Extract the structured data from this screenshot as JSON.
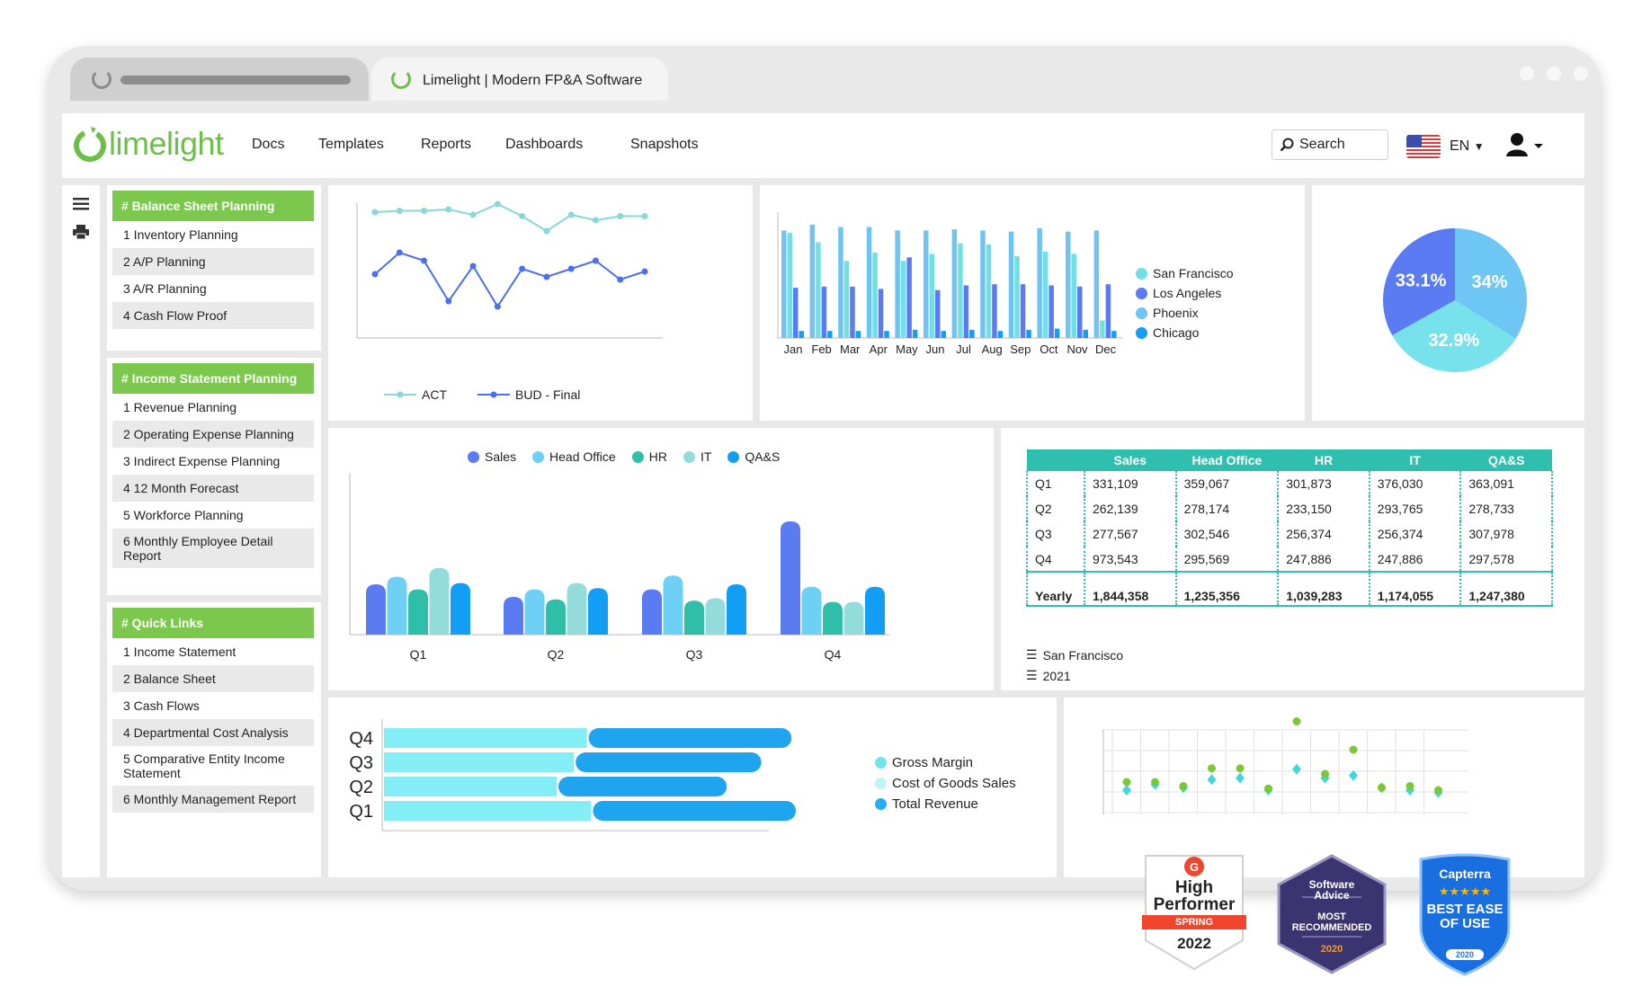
{
  "browser": {
    "tab_title": "Limelight | Modern FP&A Software"
  },
  "brand": {
    "name": "limelight",
    "color": "#6cc04a"
  },
  "nav": {
    "items": [
      "Docs",
      "Templates",
      "Reports",
      "Dashboards",
      "Snapshots"
    ],
    "search_placeholder": "Search",
    "language": "EN"
  },
  "sidebar": {
    "sections": [
      {
        "title": "# Balance Sheet Planning",
        "items": [
          "1  Inventory Planning",
          "2  A/P Planning",
          "3  A/R Planning",
          "4  Cash Flow Proof"
        ]
      },
      {
        "title": "# Income Statement Planning",
        "items": [
          "1  Revenue Planning",
          "2  Operating Expense Planning",
          "3  Indirect Expense Planning",
          "4  12 Month Forecast",
          "5  Workforce Planning",
          "6  Monthly Employee Detail Report"
        ]
      },
      {
        "title": "# Quick Links",
        "items": [
          "1  Income Statement",
          "2  Balance Sheet",
          "3  Cash Flows",
          "4  Departmental Cost Analysis",
          "5  Comparative Entity Income Statement",
          "6  Monthly Management Report"
        ]
      }
    ]
  },
  "colors": {
    "green": "#7cc84e",
    "teal": "#2ebfae",
    "act": "#86d9d6",
    "bud": "#4a6ff0",
    "sales": "#5b7bf2",
    "head_office": "#6fd0f5",
    "hr": "#2fbfa8",
    "it": "#93dcdb",
    "qas": "#139ef5"
  },
  "line_chart": {
    "legend": [
      "ACT",
      "BUD - Final"
    ],
    "series": [
      {
        "name": "ACT",
        "values": [
          88,
          89,
          89,
          90,
          86,
          94,
          85,
          74,
          86,
          82,
          85,
          85
        ]
      },
      {
        "name": "BUD - Final",
        "values": [
          42,
          58,
          52,
          22,
          48,
          18,
          46,
          40,
          46,
          52,
          38,
          44
        ]
      }
    ]
  },
  "bar_chart_monthly": {
    "categories": [
      "Jan",
      "Feb",
      "Mar",
      "Apr",
      "May",
      "Jun",
      "Jul",
      "Aug",
      "Sep",
      "Oct",
      "Nov",
      "Dec"
    ],
    "legend": [
      "San Francisco",
      "Los Angeles",
      "Phoenix",
      "Chicago"
    ],
    "series": [
      {
        "name": "San Francisco",
        "values": [
          90,
          82,
          66,
          73,
          66,
          72,
          81,
          80,
          70,
          74,
          72,
          15
        ]
      },
      {
        "name": "Los Angeles",
        "values": [
          43,
          44,
          44,
          42,
          69,
          41,
          45,
          46,
          46,
          45,
          44,
          46
        ]
      },
      {
        "name": "Phoenix",
        "values": [
          92,
          97,
          95,
          95,
          92,
          92,
          93,
          92,
          91,
          94,
          91,
          92
        ]
      },
      {
        "name": "Chicago",
        "values": [
          6,
          6,
          6,
          6,
          7,
          6,
          7,
          6,
          7,
          8,
          7,
          6
        ]
      }
    ]
  },
  "pie_chart": {
    "slices": [
      {
        "label": "34%",
        "value": 34
      },
      {
        "label": "32.9%",
        "value": 32.9
      },
      {
        "label": "33.1%",
        "value": 33.1
      }
    ]
  },
  "quarter_chart": {
    "legend": [
      "Sales",
      "Head Office",
      "HR",
      "IT",
      "QA&S"
    ],
    "categories": [
      "Q1",
      "Q2",
      "Q3",
      "Q4"
    ],
    "series": [
      {
        "name": "Sales",
        "values": [
          40,
          30,
          36,
          90
        ]
      },
      {
        "name": "Head Office",
        "values": [
          46,
          36,
          47,
          38
        ]
      },
      {
        "name": "HR",
        "values": [
          36,
          28,
          27,
          26
        ]
      },
      {
        "name": "IT",
        "values": [
          53,
          41,
          29,
          26
        ]
      },
      {
        "name": "QA&S",
        "values": [
          41,
          37,
          40,
          38
        ]
      }
    ]
  },
  "table": {
    "headers": [
      "",
      "Sales",
      "Head Office",
      "HR",
      "IT",
      "QA&S"
    ],
    "rows": [
      [
        "Q1",
        "331,109",
        "359,067",
        "301,873",
        "376,030",
        "363,091"
      ],
      [
        "Q2",
        "262,139",
        "278,174",
        "233,150",
        "293,765",
        "278,733"
      ],
      [
        "Q3",
        "277,567",
        "302,546",
        "256,374",
        "256,374",
        "307,978"
      ],
      [
        "Q4",
        "973,543",
        "295,569",
        "247,886",
        "247,886",
        "297,578"
      ]
    ],
    "total": [
      "Yearly",
      "1,844,358",
      "1,235,356",
      "1,039,283",
      "1,174,055",
      "1,247,380"
    ],
    "filters": [
      "San Francisco",
      "2021"
    ]
  },
  "hbar_chart": {
    "categories": [
      "Q4",
      "Q3",
      "Q2",
      "Q1"
    ],
    "legend": [
      "Gross Margin",
      "Cost of Goods Sales",
      "Total Revenue"
    ],
    "series": [
      {
        "name": "Cost of Goods Sales",
        "values": [
          47,
          44,
          40,
          48
        ]
      },
      {
        "name": "Total Revenue",
        "values": [
          47,
          43,
          39,
          47
        ]
      }
    ]
  },
  "scatter_chart": {
    "series": [
      {
        "name": "green",
        "values": [
          40,
          40,
          35,
          57,
          57,
          32,
          115,
          50,
          80,
          33,
          35,
          30
        ]
      },
      {
        "name": "teal",
        "values": [
          30,
          37,
          33,
          43,
          45,
          30,
          56,
          45,
          48,
          33,
          30,
          27
        ]
      }
    ]
  },
  "badges": {
    "g2": {
      "top": "High",
      "mid": "Performer",
      "ribbon": "SPRING",
      "year": "2022"
    },
    "software_advice": {
      "name1": "Software",
      "name2": "Advice",
      "line1": "MOST",
      "line2": "RECOMMENDED",
      "year": "2020"
    },
    "capterra": {
      "name": "Capterra",
      "stars": "★★★★★",
      "line1": "BEST EASE",
      "line2": "OF USE",
      "year": "2020"
    }
  }
}
